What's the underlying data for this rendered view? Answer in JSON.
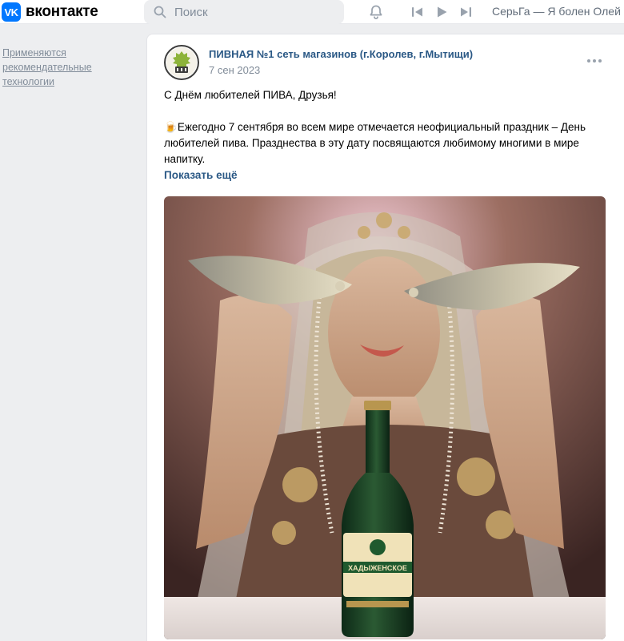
{
  "app": {
    "brand": "вконтакте",
    "logo_letters": "VK"
  },
  "header": {
    "search_placeholder": "Поиск",
    "now_playing": "СерьГа — Я болен Олей"
  },
  "left": {
    "recommendations_note": "Применяются рекомендательные технологии"
  },
  "post": {
    "author": "ПИВНАЯ №1 сеть магазинов (г.Королев, г.Мытищи)",
    "date": "7 сен 2023",
    "text_line1": "С Днём любителей ПИВА, Друзья!",
    "emoji": "🍺",
    "text_body": "Ежегодно 7 сентября во всем мире отмечается неофициальный праздник – День любителей пива. Празднества в эту дату посвящаются любимому многими в мире напитку.",
    "show_more": "Показать ещё",
    "bottle_label": "ХАДЫЖЕНСКОЕ"
  },
  "icons": {
    "search": "search-icon",
    "bell": "bell-icon",
    "prev": "skip-back-icon",
    "play": "play-icon",
    "next": "skip-forward-icon",
    "more": "more-dots-icon"
  },
  "colors": {
    "accent": "#0077ff",
    "link": "#2a5885",
    "muted": "#818c99",
    "background": "#edeef0"
  }
}
